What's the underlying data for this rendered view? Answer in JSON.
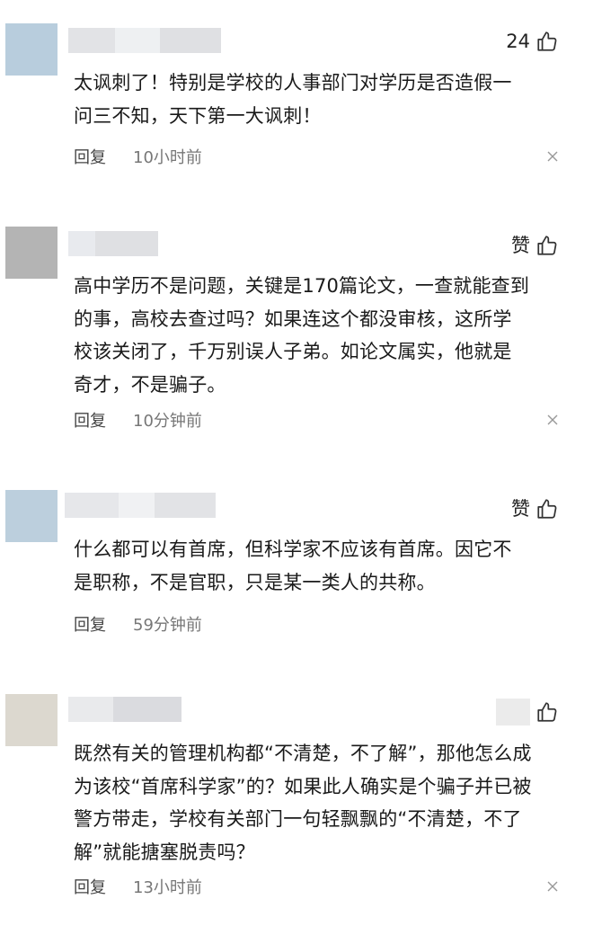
{
  "comments": [
    {
      "likes": "24",
      "text": "太讽刺了！特别是学校的人事部门对学历是否造假一\n问三不知，天下第一大讽刺！",
      "reply": "回复",
      "time": "10小时前"
    },
    {
      "likes": "赞",
      "text": "高中学历不是问题，关键是170篇论文，一查就能查到\n的事，高校去查过吗？如果连这个都没审核，这所学\n校该关闭了，千万别误人子弟。如论文属实，他就是\n奇才，不是骗子。",
      "reply": "回复",
      "time": "10分钟前"
    },
    {
      "likes": "赞",
      "text": "什么都可以有首席，但科学家不应该有首席。因它不\n是职称，不是官职，只是某一类人的共称。",
      "reply": "回复",
      "time": "59分钟前"
    },
    {
      "likes": "",
      "text": "既然有关的管理机构都“不清楚，不了解”，那他怎么成\n为该校“首席科学家”的？如果此人确实是个骗子并已被\n警方带走，学校有关部门一句轻飘飘的“不清楚，不了\n解”就能搪塞脱责吗？",
      "reply": "回复",
      "time": "13小时前"
    }
  ],
  "colors": {
    "avatar1": "#b8cddd",
    "avatar2": "#b4b4b4",
    "avatar3": "#bccfdd",
    "avatar4": "#dcd8cf",
    "name_blur_light": "#e9eaec",
    "name_blur_mid": "#dcdde0"
  },
  "icons": [
    "thumbs-up-icon",
    "close-icon"
  ]
}
